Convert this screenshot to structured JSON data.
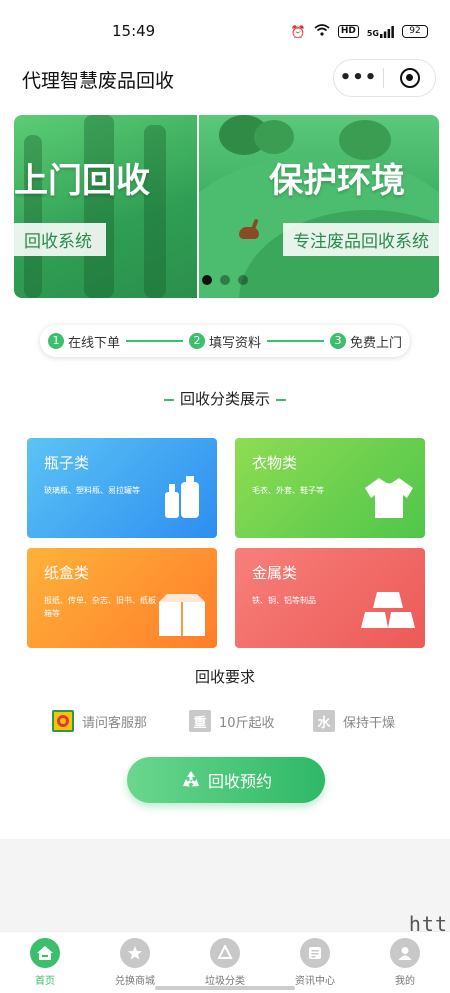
{
  "status_bar": {
    "time": "15:49",
    "network_badge": "HD",
    "signal_text": "5G",
    "battery": "92"
  },
  "nav": {
    "title": "代理智慧废品回收",
    "more_icon": "more-dots-icon",
    "target_icon": "target-circle-icon"
  },
  "banner": {
    "slides": [
      {
        "title": "上门回收",
        "subtitle": "回收系统"
      },
      {
        "title": "保护环境",
        "subtitle": "专注废品回收系统"
      }
    ],
    "active_dot": 0
  },
  "steps": [
    {
      "num": "1",
      "label": "在线下单"
    },
    {
      "num": "2",
      "label": "填写资料"
    },
    {
      "num": "3",
      "label": "免费上门"
    }
  ],
  "categories_title": "回收分类展示",
  "categories": [
    {
      "title": "瓶子类",
      "desc": "玻璃瓶、塑料瓶、易拉罐等",
      "icon": "bottles-icon"
    },
    {
      "title": "衣物类",
      "desc": "毛衣、外套、鞋子等",
      "icon": "tshirt-icon"
    },
    {
      "title": "纸盒类",
      "desc": "报纸、传单、杂志、旧书、纸板箱等",
      "icon": "box-icon"
    },
    {
      "title": "金属类",
      "desc": "铁、铜、铝等制品",
      "icon": "metal-bars-icon"
    }
  ],
  "requirements_title": "回收要求",
  "requirements": [
    {
      "icon_text": "",
      "label": "请问客服那",
      "icon": "service-logo-icon"
    },
    {
      "icon_text": "重",
      "label": "10斤起收",
      "icon": "weight-icon"
    },
    {
      "icon_text": "水",
      "label": "保持干燥",
      "icon": "water-icon"
    }
  ],
  "submit_label": "回收预约",
  "watermark": "htt",
  "tabbar": [
    {
      "label": "首页",
      "icon": "home-icon",
      "active": true
    },
    {
      "label": "兑换商城",
      "icon": "star-icon",
      "active": false
    },
    {
      "label": "垃圾分类",
      "icon": "recycle-icon",
      "active": false
    },
    {
      "label": "资讯中心",
      "icon": "news-icon",
      "active": false
    },
    {
      "label": "我的",
      "icon": "user-icon",
      "active": false
    }
  ],
  "colors": {
    "brand_green": "#3cbf6c",
    "bottle_card": "#2d8ef0",
    "clothes_card": "#4fc64b",
    "paper_card": "#ff7d2a",
    "metal_card": "#ec5a57"
  }
}
